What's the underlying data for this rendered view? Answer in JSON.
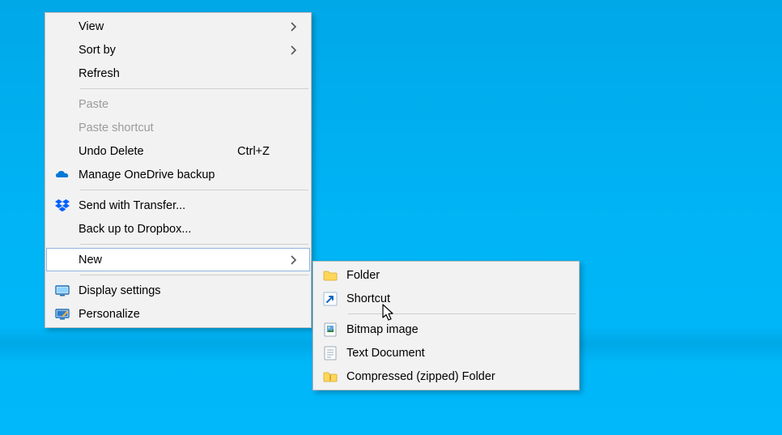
{
  "main_menu": {
    "view": "View",
    "sort_by": "Sort by",
    "refresh": "Refresh",
    "paste": "Paste",
    "paste_shortcut": "Paste shortcut",
    "undo_delete": "Undo Delete",
    "undo_delete_accel": "Ctrl+Z",
    "manage_onedrive": "Manage OneDrive backup",
    "send_transfer": "Send with Transfer...",
    "backup_dropbox": "Back up to Dropbox...",
    "new": "New",
    "display_settings": "Display settings",
    "personalize": "Personalize"
  },
  "sub_menu": {
    "folder": "Folder",
    "shortcut": "Shortcut",
    "bitmap": "Bitmap image",
    "text_doc": "Text Document",
    "zip": "Compressed (zipped) Folder"
  }
}
